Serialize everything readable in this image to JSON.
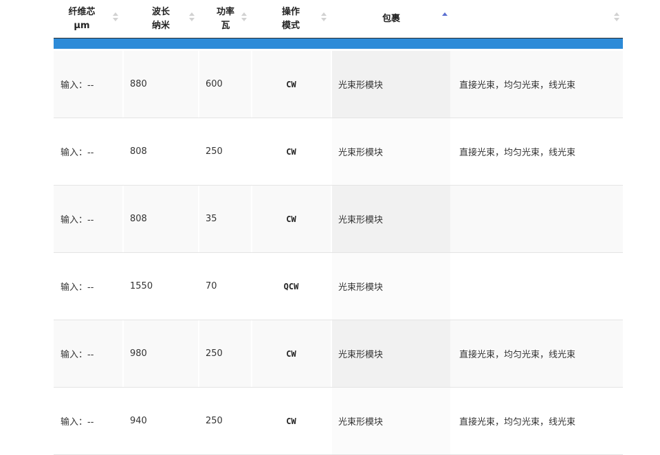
{
  "colors": {
    "accent_bar": "#2d8bd8",
    "sort_active": "#5b6fd1",
    "sort_inactive": "#d2d2d2"
  },
  "headers": [
    {
      "line1": "纤维芯",
      "line2": "μm",
      "sort": "none"
    },
    {
      "line1": "波长",
      "line2": "纳米",
      "sort": "none"
    },
    {
      "line1": "功率",
      "line2": "瓦",
      "sort": "none"
    },
    {
      "line1": "操作",
      "line2": "模式",
      "sort": "none"
    },
    {
      "line1": "包裹",
      "line2": "",
      "sort": "ascending"
    },
    {
      "line1": "",
      "line2": "",
      "sort": "none"
    }
  ],
  "rows": [
    {
      "core": "输入：--",
      "wavelength": "880",
      "power": "600",
      "mode": "CW",
      "package": "光束形模块",
      "desc": "直接光束，均匀光束，线光束"
    },
    {
      "core": "输入：--",
      "wavelength": "808",
      "power": "250",
      "mode": "CW",
      "package": "光束形模块",
      "desc": "直接光束，均匀光束，线光束"
    },
    {
      "core": "输入：--",
      "wavelength": "808",
      "power": "35",
      "mode": "CW",
      "package": "光束形模块",
      "desc": ""
    },
    {
      "core": "输入：--",
      "wavelength": "1550",
      "power": "70",
      "mode": "QCW",
      "package": "光束形模块",
      "desc": ""
    },
    {
      "core": "输入：--",
      "wavelength": "980",
      "power": "250",
      "mode": "CW",
      "package": "光束形模块",
      "desc": "直接光束，均匀光束，线光束"
    },
    {
      "core": "输入：--",
      "wavelength": "940",
      "power": "250",
      "mode": "CW",
      "package": "光束形模块",
      "desc": "直接光束，均匀光束，线光束"
    }
  ]
}
